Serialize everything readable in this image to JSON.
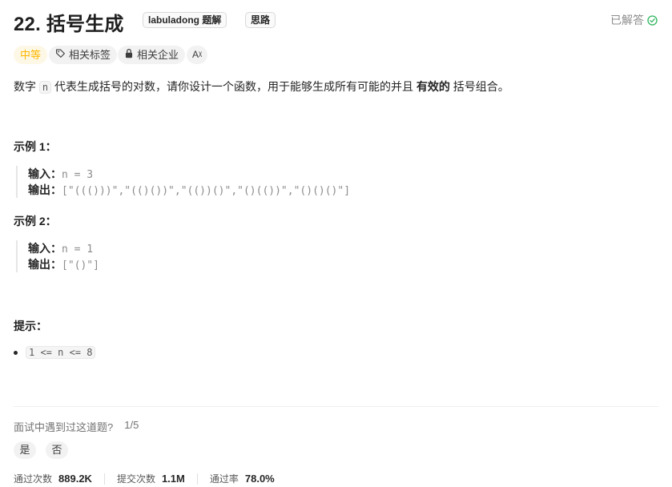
{
  "problem": {
    "title": "22. 括号生成",
    "tag_labuladong": "labuladong 题解",
    "tag_silu": "思路",
    "solved_label": "已解答"
  },
  "chips": {
    "difficulty": "中等",
    "related_tags": "相关标签",
    "related_companies": "相关企业",
    "translate": "Aᵡ"
  },
  "description": {
    "part1": "数字 ",
    "code_n": "n",
    "part2": " 代表生成括号的对数，请你设计一个函数，用于能够生成所有可能的并且 ",
    "bold": "有效的",
    "part3": " 括号组合。"
  },
  "examples": [
    {
      "heading": "示例 1：",
      "input_label": "输入：",
      "input_value": "n = 3",
      "output_label": "输出：",
      "output_value": "[\"((()))\",\"(()())\",\"(())()\",\"()(())\",\"()()()\"]"
    },
    {
      "heading": "示例 2：",
      "input_label": "输入：",
      "input_value": "n = 1",
      "output_label": "输出：",
      "output_value": "[\"()\"]"
    }
  ],
  "hints": {
    "heading": "提示：",
    "constraint": "1 <= n <= 8"
  },
  "interview": {
    "question": "面试中遇到过这道题?",
    "count": "1/5",
    "yes": "是",
    "no": "否"
  },
  "stats": {
    "accepted_label": "通过次数",
    "accepted_value": "889.2K",
    "submissions_label": "提交次数",
    "submissions_value": "1.1M",
    "rate_label": "通过率",
    "rate_value": "78.0%"
  },
  "colors": {
    "medium": "#ffb800",
    "solved_check": "#2db55d"
  }
}
